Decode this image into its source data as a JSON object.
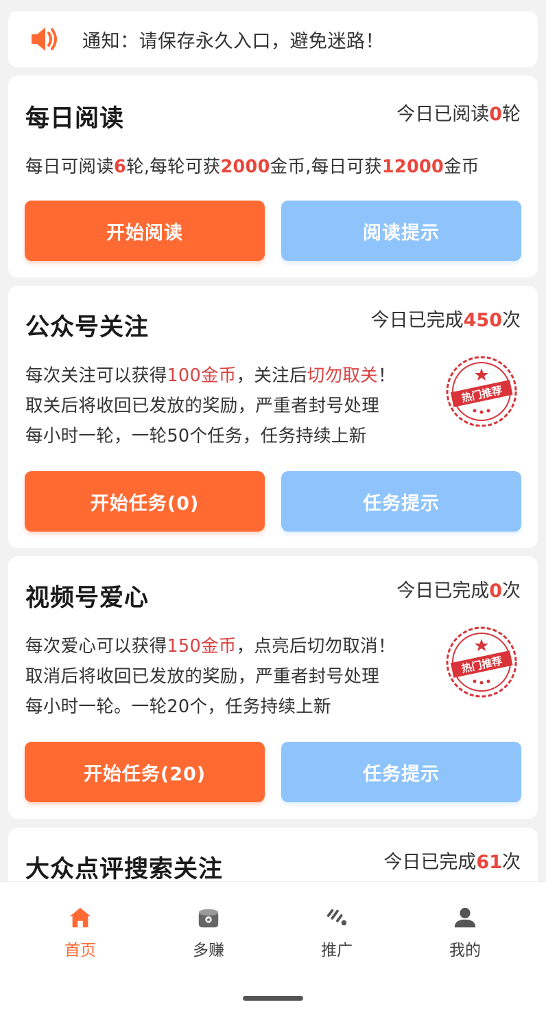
{
  "notice": {
    "text": "通知：请保存永久入口，避免迷路！"
  },
  "colors": {
    "accent": "#ff6a33",
    "secondary": "#8ec4fb",
    "highlight": "#e9463d"
  },
  "cards": [
    {
      "title": "每日阅读",
      "status": {
        "prefix": "今日已阅读",
        "value": "0",
        "suffix": "轮"
      },
      "desc": {
        "p1": "每日可阅读",
        "v1": "6",
        "p2": "轮,每轮可获",
        "v2": "2000",
        "p3": "金币,每日可获",
        "v3": "12000",
        "p4": "金币"
      },
      "primary_button": "开始阅读",
      "secondary_button": "阅读提示"
    },
    {
      "title": "公众号关注",
      "status": {
        "prefix": "今日已完成",
        "value": "450",
        "suffix": "次"
      },
      "lines": {
        "l1a": "每次关注可以获得",
        "l1b": "100金币",
        "l1c": "，关注后",
        "l1d": "切勿取关",
        "l1e": "！",
        "l2": "取关后将收回已发放的奖励，严重者封号处理",
        "l3": "每小时一轮，一轮50个任务，任务持续上新"
      },
      "stamp": "热门推荐",
      "primary_button": "开始任务(0)",
      "secondary_button": "任务提示"
    },
    {
      "title": "视频号爱心",
      "status": {
        "prefix": "今日已完成",
        "value": "0",
        "suffix": "次"
      },
      "lines": {
        "l1a": "每次爱心可以获得",
        "l1b": "150金币",
        "l1c": "，点亮后切勿取消！",
        "l2": "取消后将收回已发放的奖励，严重者封号处理",
        "l3": "每小时一轮。一轮20个，任务持续上新"
      },
      "stamp": "热门推荐",
      "primary_button": "开始任务(20)",
      "secondary_button": "任务提示"
    },
    {
      "title": "大众点评搜索关注",
      "status": {
        "prefix": "今日已完成",
        "value": "61",
        "suffix": "次"
      }
    }
  ],
  "tabs": [
    {
      "label": "首页",
      "icon": "home-icon",
      "active": true
    },
    {
      "label": "多赚",
      "icon": "earn-icon",
      "active": false
    },
    {
      "label": "推广",
      "icon": "promote-icon",
      "active": false
    },
    {
      "label": "我的",
      "icon": "user-icon",
      "active": false
    }
  ]
}
